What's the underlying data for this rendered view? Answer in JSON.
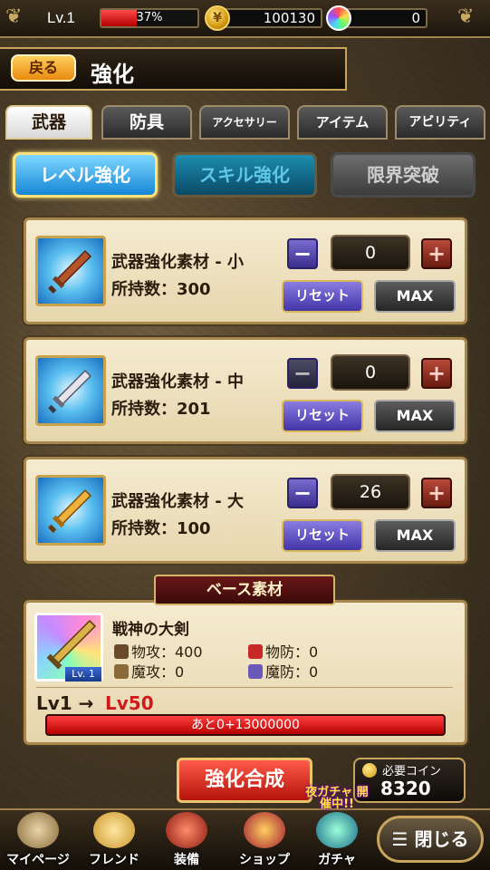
{
  "status": {
    "level_label": "Lv.1",
    "exp_percent_text": "37%",
    "exp_fraction": 0.37,
    "coins": "100130",
    "gems": "0"
  },
  "header": {
    "back_label": "戻る",
    "title": "強化"
  },
  "tabs": [
    {
      "label": "武器",
      "active": true
    },
    {
      "label": "防具",
      "active": false
    },
    {
      "label": "アクセサリー",
      "active": false
    },
    {
      "label": "アイテム",
      "active": false
    },
    {
      "label": "アビリティ",
      "active": false
    }
  ],
  "modes": {
    "level": "レベル強化",
    "skill": "スキル強化",
    "limit": "限界突破"
  },
  "materials": [
    {
      "name": "武器強化素材 - 小",
      "owned": "所持数：300",
      "qty": "0",
      "reset": "リセット",
      "max": "MAX"
    },
    {
      "name": "武器強化素材 - 中",
      "owned": "所持数：201",
      "qty": "0",
      "reset": "リセット",
      "max": "MAX"
    },
    {
      "name": "武器強化素材 - 大",
      "owned": "所持数：100",
      "qty": "26",
      "reset": "リセット",
      "max": "MAX"
    }
  ],
  "controls": {
    "minus": "−",
    "plus": "+"
  },
  "base": {
    "header": "ベース素材",
    "name": "戦神の大剣",
    "thumb_level": "Lv. 1",
    "stats": {
      "patk": "物攻：400",
      "pdef": "物防：0",
      "matk": "魔攻：0",
      "mdef": "魔防：0"
    },
    "lv_from": "Lv1 →",
    "lv_to": "Lv50",
    "remaining": "あと0+13000000"
  },
  "actions": {
    "synth": "強化合成",
    "cost_label": "必要コイン",
    "cost_value": "8320"
  },
  "nav": [
    {
      "label": "マイページ",
      "icon": "scroll-icon"
    },
    {
      "label": "フレンド",
      "icon": "friends-icon"
    },
    {
      "label": "装備",
      "icon": "equipment-icon"
    },
    {
      "label": "ショップ",
      "icon": "shop-chest-icon"
    },
    {
      "label": "ガチャ",
      "icon": "gacha-orb-icon"
    }
  ],
  "gacha_badge": "夜ガチャ 開催中!!",
  "close_label": "☰ 閉じる"
}
